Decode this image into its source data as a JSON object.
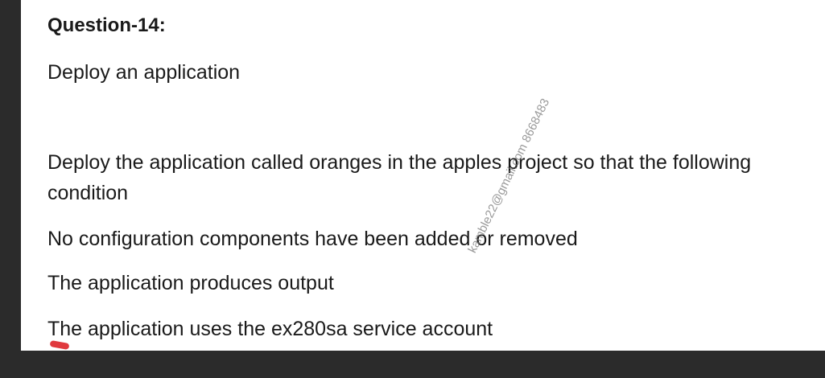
{
  "document": {
    "heading": "Question-14:",
    "subtitle": "Deploy an application",
    "lines": [
      "Deploy the application called oranges in the apples project so that the following",
      "condition",
      "No configuration components have been added or removed",
      "The application produces output",
      "The application uses the ex280sa service account"
    ],
    "watermark": "kamble22@gmail.com 8668483"
  },
  "colors": {
    "background": "#2b2b2b",
    "page": "#ffffff",
    "pen_mark": "#e0393e"
  }
}
